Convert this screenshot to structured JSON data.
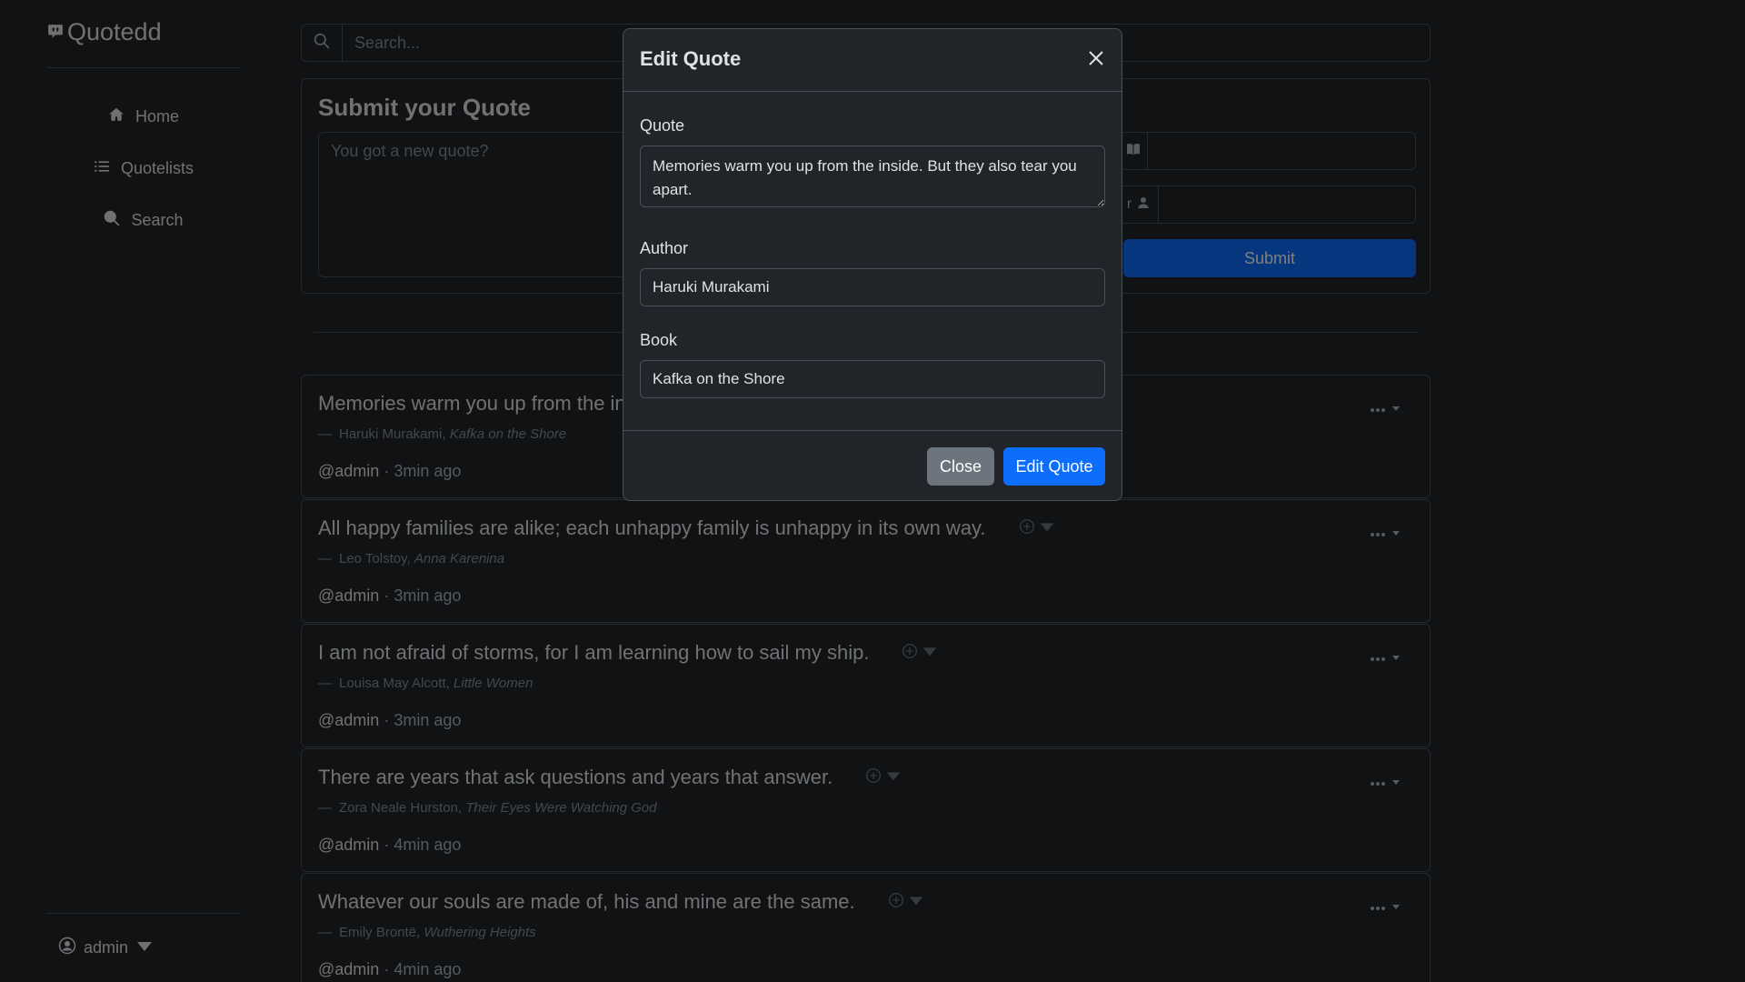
{
  "brand": {
    "name": "Quotedd"
  },
  "sidebar": {
    "items": [
      {
        "label": "Home",
        "icon": "home-icon"
      },
      {
        "label": "Quotelists",
        "icon": "list-icon"
      },
      {
        "label": "Search",
        "icon": "search-icon"
      }
    ],
    "user": "admin"
  },
  "search": {
    "placeholder": "Search..."
  },
  "submit": {
    "title": "Submit your Quote",
    "placeholder": "You got a new quote?",
    "button": "Submit",
    "author_addon_fragment": "r"
  },
  "quotes": [
    {
      "text": "Memories warm you up from the inside. But they also tear you apart.",
      "author": "Haruki Murakami",
      "book": "Kafka on the Shore",
      "user": "@admin",
      "time": "3min ago"
    },
    {
      "text": "All happy families are alike; each unhappy family is unhappy in its own way.",
      "author": "Leo Tolstoy",
      "book": "Anna Karenina",
      "user": "@admin",
      "time": "3min ago"
    },
    {
      "text": "I am not afraid of storms, for I am learning how to sail my ship.",
      "author": "Louisa May Alcott",
      "book": "Little Women",
      "user": "@admin",
      "time": "3min ago"
    },
    {
      "text": "There are years that ask questions and years that answer.",
      "author": "Zora Neale Hurston",
      "book": "Their Eyes Were Watching God",
      "user": "@admin",
      "time": "4min ago"
    },
    {
      "text": "Whatever our souls are made of, his and mine are the same.",
      "author": "Emily Brontë",
      "book": "Wuthering Heights",
      "user": "@admin",
      "time": "4min ago"
    }
  ],
  "modal": {
    "title": "Edit Quote",
    "quote_label": "Quote",
    "quote_value": "Memories warm you up from the inside. But they also tear you apart.",
    "author_label": "Author",
    "author_value": "Haruki Murakami",
    "book_label": "Book",
    "book_value": "Kafka on the Shore",
    "close_button": "Close",
    "submit_button": "Edit Quote"
  },
  "colors": {
    "background": "#212529",
    "border": "#495057",
    "primary": "#0d6efd",
    "secondary": "#6c757d"
  }
}
